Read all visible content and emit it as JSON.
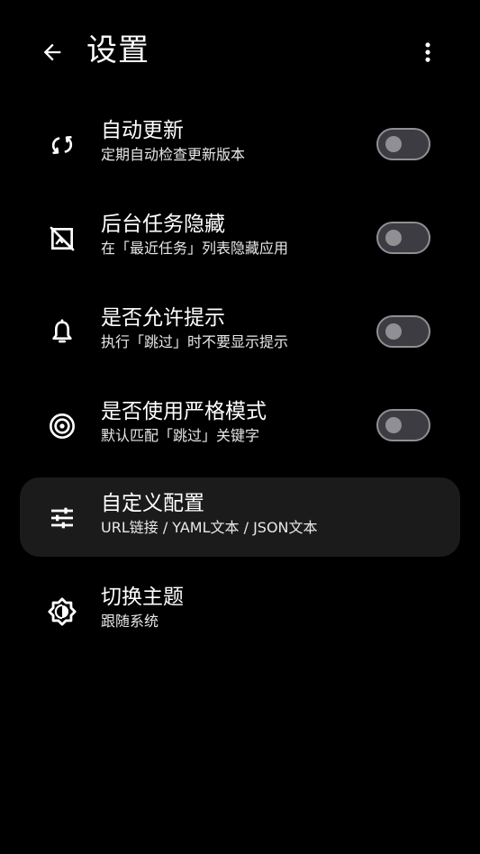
{
  "header": {
    "title": "设置",
    "back_icon": "arrow-back-icon",
    "more_icon": "more-vert-icon"
  },
  "settings": [
    {
      "title": "自动更新",
      "subtitle": "定期自动检查更新版本",
      "icon": "sync-icon",
      "toggle": true,
      "enabled": false
    },
    {
      "title": "后台任务隐藏",
      "subtitle": "在「最近任务」列表隐藏应用",
      "icon": "hide-image-icon",
      "toggle": true,
      "enabled": false
    },
    {
      "title": "是否允许提示",
      "subtitle": "执行「跳过」时不要显示提示",
      "icon": "notification-bell-icon",
      "toggle": true,
      "enabled": false
    },
    {
      "title": "是否使用严格模式",
      "subtitle": "默认匹配「跳过」关键字",
      "icon": "target-icon",
      "toggle": true,
      "enabled": false
    },
    {
      "title": "自定义配置",
      "subtitle": "URL链接 / YAML文本 / JSON文本",
      "icon": "tune-icon",
      "toggle": false
    },
    {
      "title": "切换主题",
      "subtitle": "跟随系统",
      "icon": "brightness-icon",
      "toggle": false
    }
  ],
  "colors": {
    "background": "#000000",
    "highlight_row": "#1b1b1b",
    "toggle_track": "#3c3c42",
    "toggle_outline": "#8f8f94"
  }
}
